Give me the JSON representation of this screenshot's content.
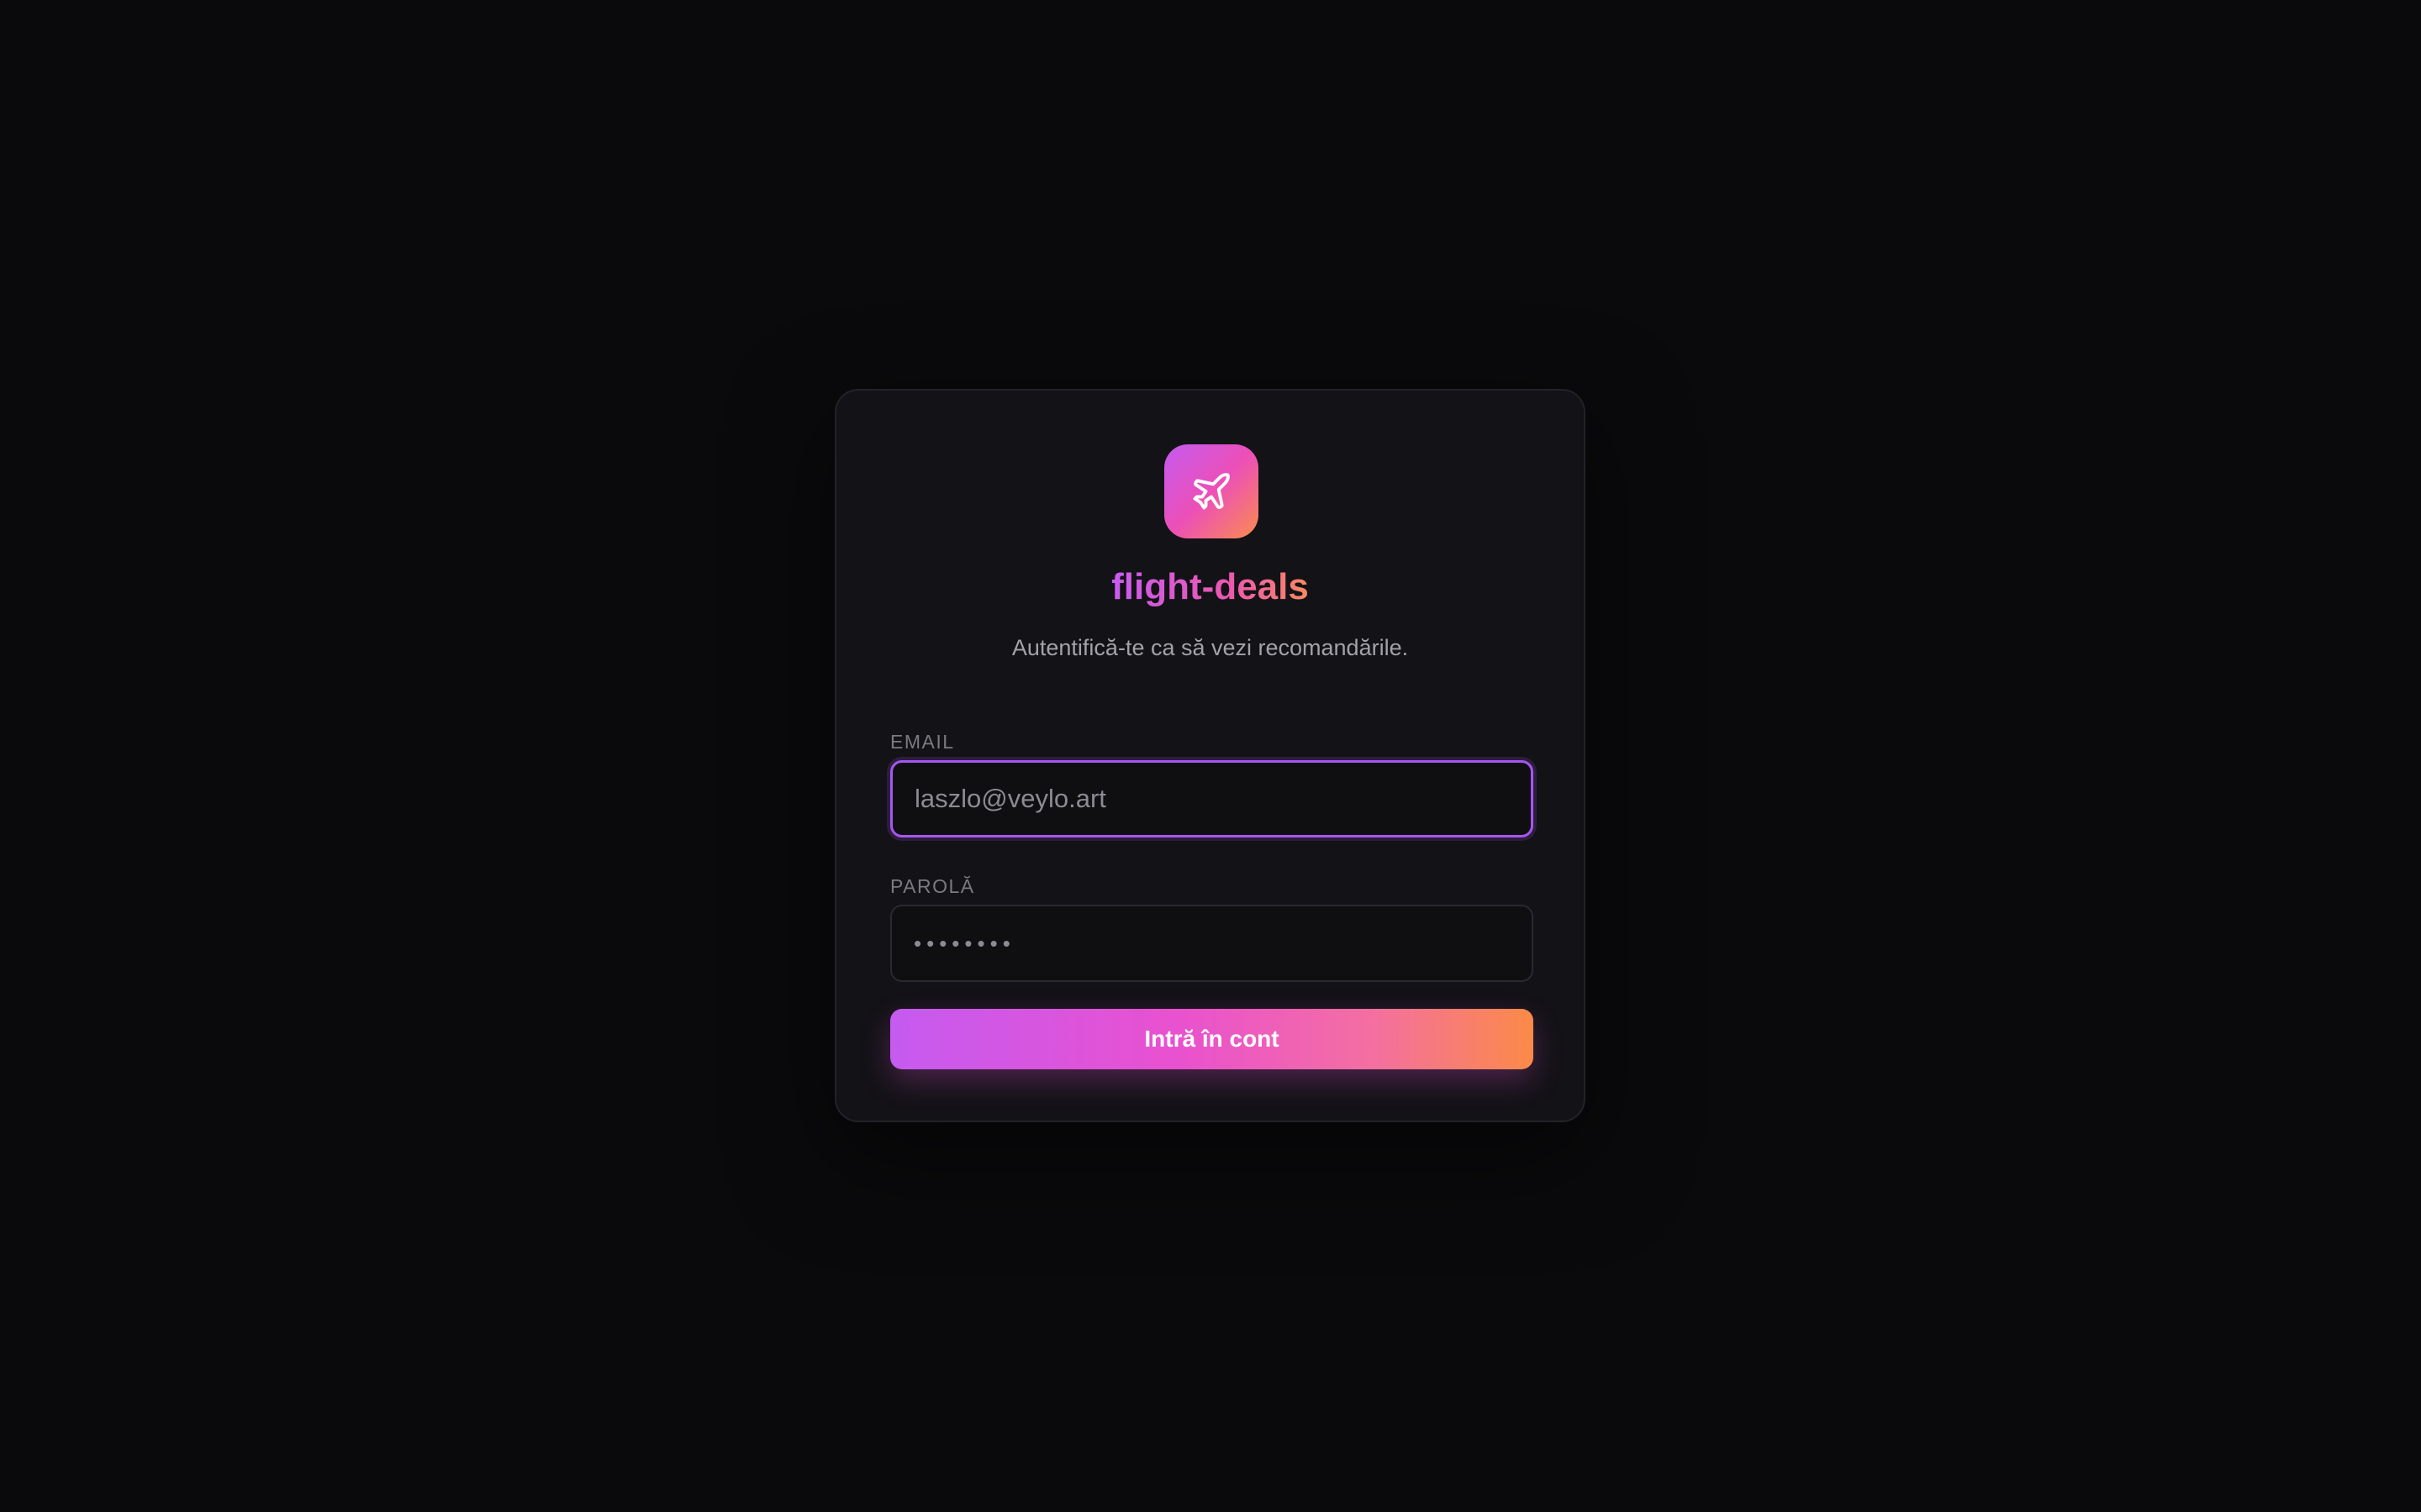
{
  "app": {
    "title": "flight-deals",
    "subtitle": "Autentifică-te ca să vezi recomandările.",
    "logo_icon": "airplane-icon"
  },
  "form": {
    "email_label": "EMAIL",
    "email_value": "laszlo@veylo.art",
    "password_label": "PAROLĂ",
    "password_value": "••••••••",
    "submit_label": "Intră în cont"
  },
  "colors": {
    "background": "#0a0a0c",
    "card": "#131217",
    "accent_start": "#c55bf0",
    "accent_mid": "#ec4fb8",
    "accent_end": "#fb8a48",
    "focus_border": "#a656f0"
  }
}
